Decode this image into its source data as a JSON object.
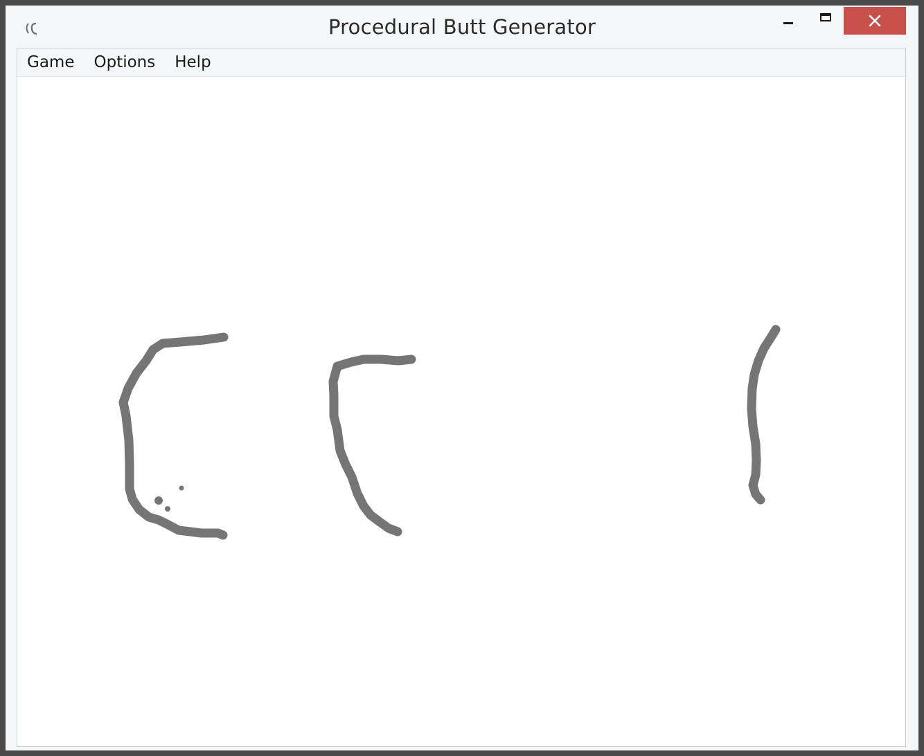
{
  "window": {
    "title": "Procedural Butt Generator",
    "icon": "app-icon",
    "buttons": {
      "minimize_icon": "minimize-icon",
      "maximize_icon": "maximize-icon",
      "close_icon": "close-icon",
      "close_glyph": "✕"
    }
  },
  "menubar": {
    "items": [
      {
        "label": "Game"
      },
      {
        "label": "Options"
      },
      {
        "label": "Help"
      }
    ]
  },
  "canvas": {
    "stroke_color": "#757575",
    "close_button_color": "#c7504b"
  }
}
